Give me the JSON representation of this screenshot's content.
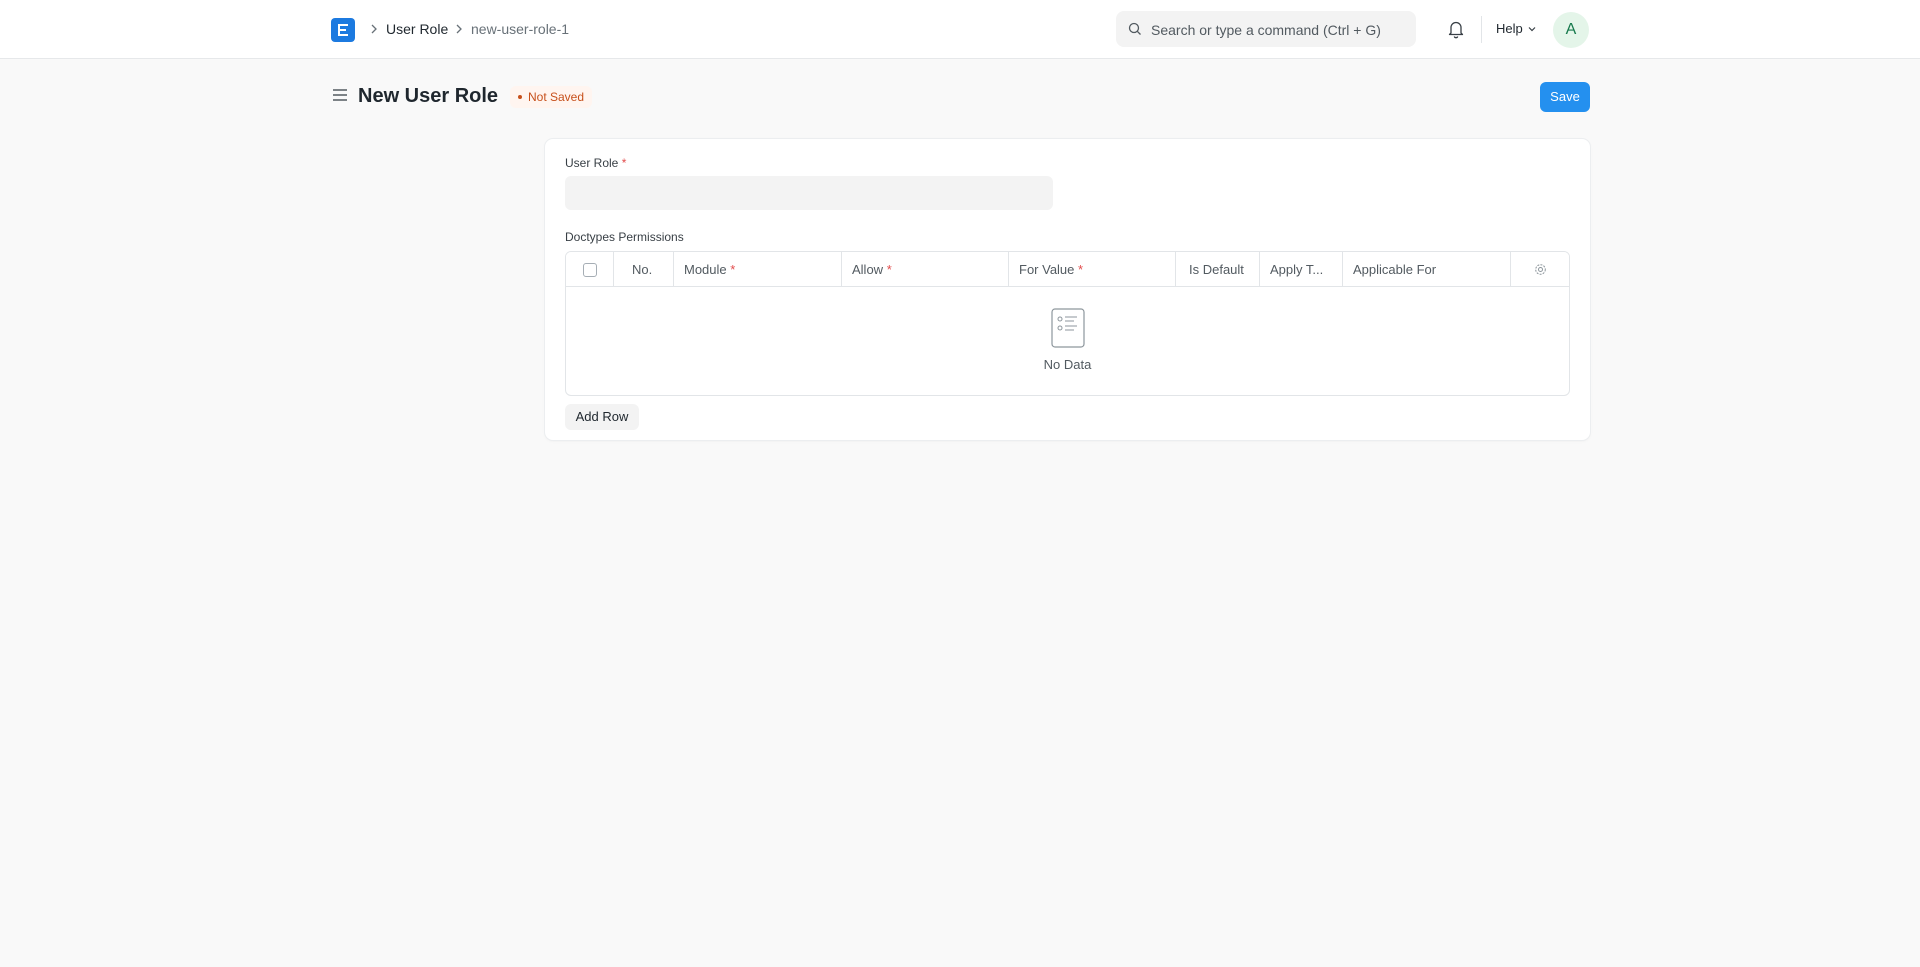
{
  "navbar": {
    "logo_letter": "E",
    "breadcrumbs": [
      "User Role",
      "new-user-role-1"
    ],
    "search_placeholder": "Search or type a command (Ctrl + G)",
    "help_label": "Help",
    "avatar_initial": "A"
  },
  "page": {
    "title": "New User Role",
    "status": "Not Saved",
    "save_label": "Save"
  },
  "form": {
    "user_role_label": "User Role",
    "user_role_value": "",
    "permissions_label": "Doctypes Permissions",
    "grid_columns": [
      {
        "label": "No.",
        "required": false
      },
      {
        "label": "Module",
        "required": true
      },
      {
        "label": "Allow",
        "required": true
      },
      {
        "label": "For Value",
        "required": true
      },
      {
        "label": "Is Default",
        "required": false
      },
      {
        "label": "Apply T...",
        "required": false
      },
      {
        "label": "Applicable For",
        "required": false
      }
    ],
    "empty_text": "No Data",
    "add_row_label": "Add Row"
  },
  "colors": {
    "primary": "#2490ef",
    "logo": "#1c7ae0",
    "status_text": "#c7501b",
    "required_star": "#e24c4c"
  },
  "icons": [
    "frappe-logo-icon",
    "chevron-right-icon",
    "search-icon",
    "bell-icon",
    "chevron-down-icon",
    "hamburger-icon",
    "gear-icon",
    "empty-list-icon"
  ]
}
